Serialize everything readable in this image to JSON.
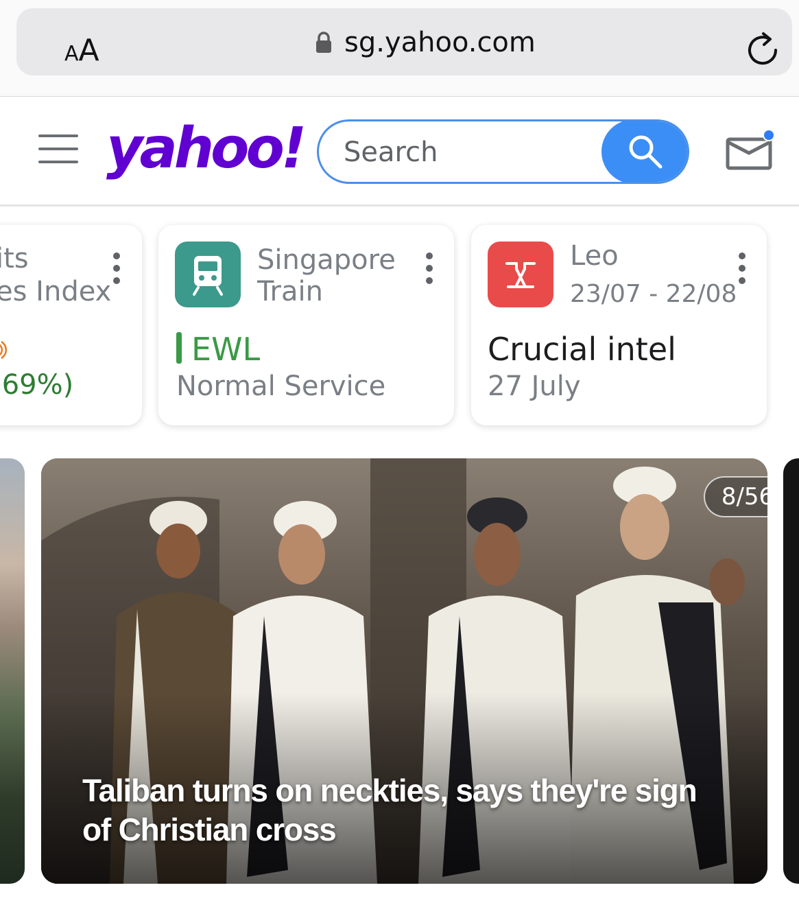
{
  "browser": {
    "text_size_small": "A",
    "text_size_big": "A",
    "url": "sg.yahoo.com"
  },
  "header": {
    "logo": "yahoo!",
    "search_placeholder": "Search"
  },
  "cards": [
    {
      "title_line1": "its",
      "title_line2": "es Index",
      "value": ".69%)",
      "value_color": "#2e7d32"
    },
    {
      "title_line1": "Singapore",
      "title_line2": "Train",
      "line_code": "EWL",
      "status": "Normal Service",
      "line_color": "#3a9a46",
      "icon_bg": "#3b9a8c"
    },
    {
      "title_line1": "Leo",
      "date_range": "23/07 - 22/08",
      "headline": "Crucial intel",
      "date": "27 July",
      "icon_bg": "#e94b4b"
    }
  ],
  "hero": {
    "counter": "8/56",
    "headline": "Taliban turns on neckties, says they're sign of Christian cross"
  },
  "colors": {
    "yahoo_purple": "#6001d2",
    "search_blue": "#3b8ef5",
    "notification_dot": "#2f7df6"
  }
}
